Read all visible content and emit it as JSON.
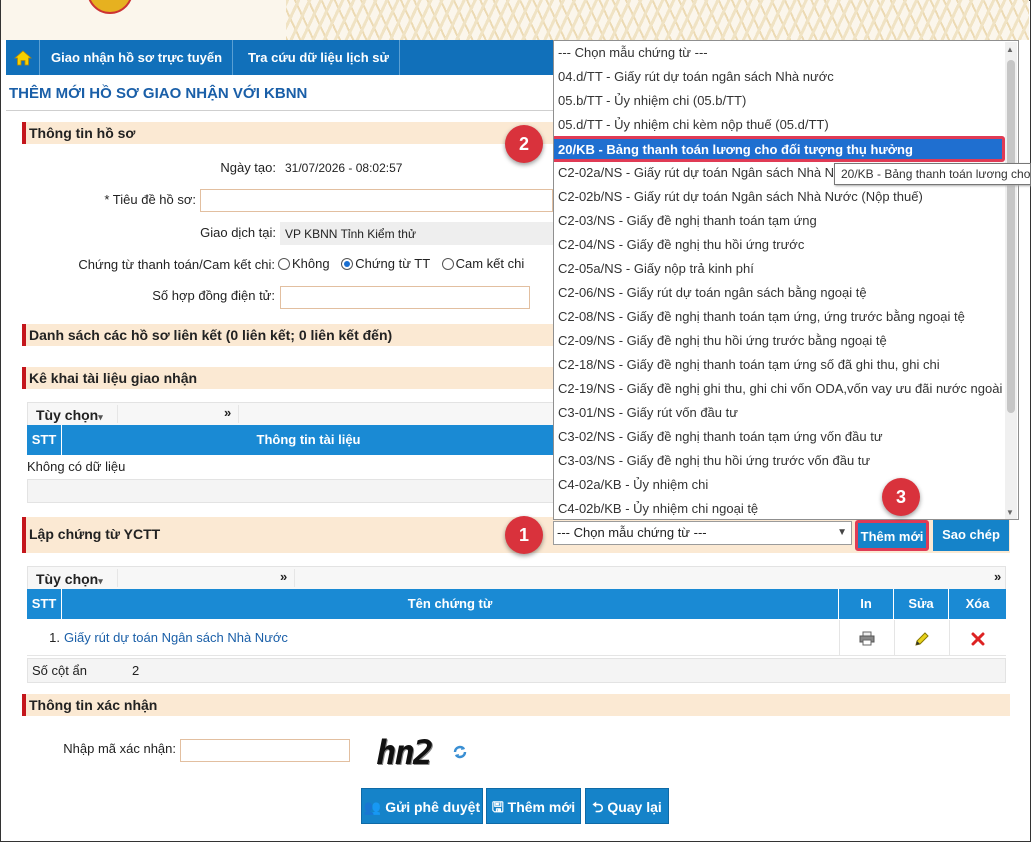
{
  "nav": {
    "items": [
      "Giao nhận hồ sơ trực tuyến",
      "Tra cứu dữ liệu lịch sử"
    ]
  },
  "page": {
    "title": "THÊM MỚI HỒ SƠ GIAO NHẬN VỚI KBNN"
  },
  "sections": {
    "info": "Thông tin hồ sơ",
    "linked": "Danh sách các hồ sơ liên kết (0 liên kết; 0 liên kết đến)",
    "docs": "Kê khai tài liệu giao nhận",
    "vouchers": "Lập chứng từ YCTT",
    "confirm": "Thông tin xác nhận"
  },
  "form": {
    "created_label": "Ngày tạo:",
    "created_value": "31/07/2026 - 08:02:57",
    "title_label": "* Tiêu đề hồ sơ:",
    "place_label": "Giao dịch tại:",
    "place_value": "VP KBNN Tỉnh Kiểm thử",
    "voucher_label": "Chứng từ thanh toán/Cam kết chi:",
    "radio": [
      "Không",
      "Chứng từ TT",
      "Cam kết chi"
    ],
    "contract_label": "Số hợp đồng điện tử:"
  },
  "docs_table": {
    "option": "Tùy chọn",
    "more": "»",
    "headers": [
      "STT",
      "Thông tin tài liệu"
    ],
    "empty": "Không có dữ liệu"
  },
  "voucher_table": {
    "option": "Tùy chọn",
    "more": "»",
    "headers": [
      "STT",
      "Tên chứng từ",
      "In",
      "Sửa",
      "Xóa"
    ],
    "rows": [
      {
        "stt": "1.",
        "name": "Giấy rút dự toán Ngân sách Nhà Nước"
      }
    ],
    "hidden_label": "Số cột ẩn",
    "hidden_value": "2"
  },
  "select": {
    "value": "--- Chọn mẫu chứng từ ---"
  },
  "buttons": {
    "add": "Thêm mới",
    "copy": "Sao chép",
    "send": "Gửi phê duyệt",
    "save": "Thêm mới",
    "back": "Quay lại"
  },
  "dropdown": {
    "options": [
      "--- Chọn mẫu chứng từ ---",
      "04.d/TT - Giấy rút dự toán ngân sách Nhà nước",
      "05.b/TT - Ủy nhiệm chi (05.b/TT)",
      "05.d/TT - Ủy nhiệm chi kèm nộp thuế (05.d/TT)",
      "20/KB - Bảng thanh toán lương cho đối tượng thụ hưởng",
      "C2-02a/NS - Giấy rút dự toán Ngân sách Nhà N",
      "C2-02b/NS - Giấy rút dự toán Ngân sách Nhà Nước (Nộp thuế)",
      "C2-03/NS - Giấy đề nghị thanh toán tạm ứng",
      "C2-04/NS - Giấy đề nghị thu hồi ứng trước",
      "C2-05a/NS - Giấy nộp trả kinh phí",
      "C2-06/NS - Giấy rút dự toán ngân sách bằng ngoại tệ",
      "C2-08/NS - Giấy đề nghị thanh toán tạm ứng, ứng trước bằng ngoại tệ",
      "C2-09/NS - Giấy đề nghị thu hồi ứng trước bằng ngoại tệ",
      "C2-18/NS - Giấy đề nghị thanh toán tạm ứng số đã ghi thu, ghi chi",
      "C2-19/NS - Giấy đề nghị ghi thu, ghi chi vốn ODA,vốn vay ưu đãi nước ngoài",
      "C3-01/NS - Giấy rút vốn đầu tư",
      "C3-02/NS - Giấy đề nghị thanh toán tạm ứng vốn đầu tư",
      "C3-03/NS - Giấy đề nghị thu hồi ứng trước vốn đầu tư",
      "C4-02a/KB - Ủy nhiệm chi",
      "C4-02b/KB - Ủy nhiệm chi ngoại tệ"
    ],
    "highlighted_index": 4
  },
  "tooltip": "20/KB - Bảng thanh toán lương cho",
  "confirm": {
    "label": "Nhập mã xác nhận:",
    "captcha": "hn2"
  },
  "annotations": [
    "1",
    "2",
    "3"
  ],
  "colors": {
    "accent": "#1583c9",
    "highlight": "#1f6fd0",
    "badge": "#d9323c",
    "section_bg": "#fbe9d3"
  }
}
